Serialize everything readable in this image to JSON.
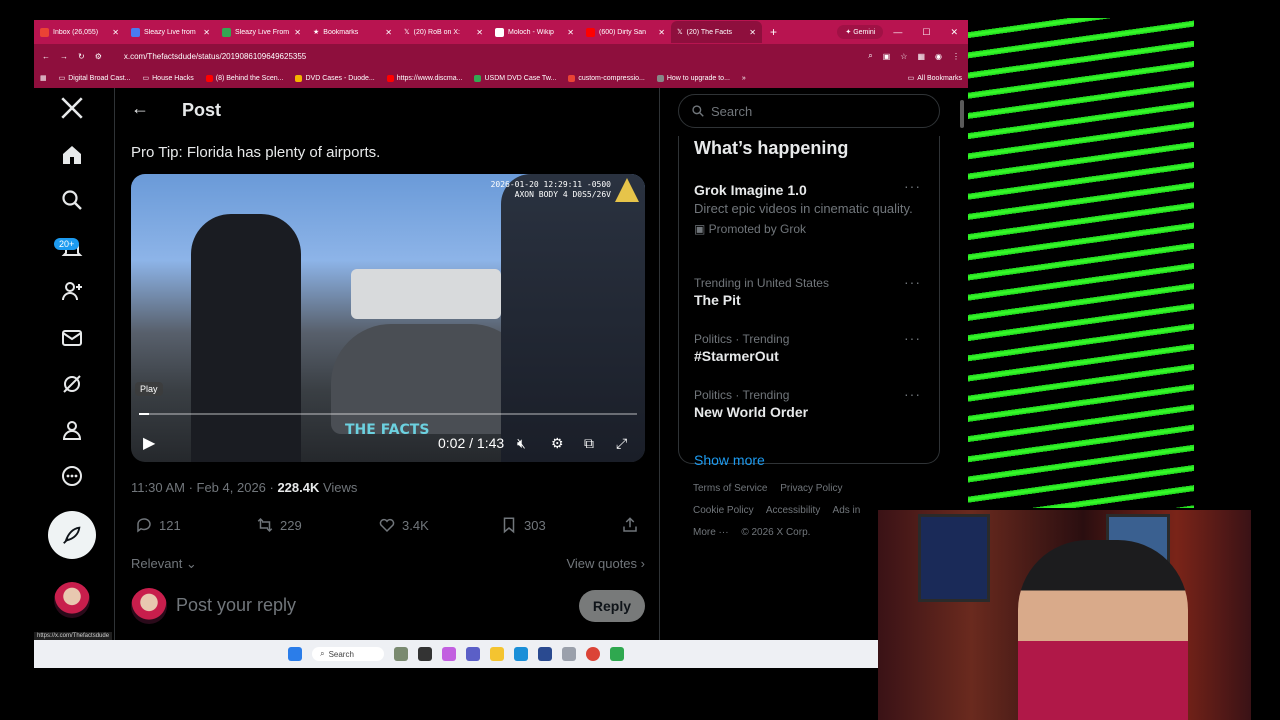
{
  "browser": {
    "tabs": [
      {
        "label": "Inbox (26,055)",
        "color": "#ea4335"
      },
      {
        "label": "Sleazy Live from",
        "color": "#4a7cf0"
      },
      {
        "label": "Sleazy Live From",
        "color": "#34a853"
      },
      {
        "label": "Bookmarks",
        "color": "#ffffff"
      },
      {
        "label": "(20) RoB on X:",
        "color": "#000000"
      },
      {
        "label": "Moloch - Wikip",
        "color": "#ffffff"
      },
      {
        "label": "(600) Dirty San",
        "color": "#ff0000"
      },
      {
        "label": "(20) The Facts",
        "color": "#000000"
      }
    ],
    "gemini_label": "Gemini",
    "url": "x.com/Thefactsdude/status/2019086109649625355",
    "bookmarks": [
      {
        "label": "Digital Broad Cast...",
        "color": "#4a7cf0"
      },
      {
        "label": "House Hacks",
        "color": "#f4b400"
      },
      {
        "label": "(8) Behind the Scen...",
        "color": "#ff0000"
      },
      {
        "label": "DVD Cases - Duode...",
        "color": "#f4b400"
      },
      {
        "label": "https://www.discma...",
        "color": "#ff0000"
      },
      {
        "label": "USDM DVD Case Tw...",
        "color": "#34a853"
      },
      {
        "label": "custom-compressio...",
        "color": "#ea4335"
      },
      {
        "label": "How to upgrade to...",
        "color": "#888888"
      }
    ],
    "all_bookmarks": "All Bookmarks",
    "status_url": "https://x.com/Thefactsdude"
  },
  "nav": {
    "notification_badge": "20+"
  },
  "post": {
    "header_title": "Post",
    "text": "Pro Tip: Florida has plenty of airports.",
    "video": {
      "timestamp_line1": "2026-01-20 12:29:11 -0500",
      "timestamp_line2": "AXON BODY 4 D0S5/26V",
      "play_tooltip": "Play",
      "time": "0:02 / 1:43",
      "watermark": "THE FACTS",
      "progress": 0.02
    },
    "meta_time": "11:30 AM · Feb 4, 2026 · ",
    "views_count": "228.4K",
    "views_label": " Views",
    "replies": "121",
    "reposts": "229",
    "likes": "3.4K",
    "bookmarks": "303",
    "sort_label": "Relevant",
    "view_quotes": "View quotes",
    "reply_placeholder": "Post your reply",
    "reply_button": "Reply"
  },
  "sidebar": {
    "search_placeholder": "Search",
    "whats_happening": "What’s happening",
    "trends": [
      {
        "name": "Grok Imagine 1.0",
        "desc": "Direct epic videos in cinematic quality.",
        "promo": "Promoted by Grok"
      },
      {
        "category": "Trending in United States",
        "name": "The Pit"
      },
      {
        "category": "Politics · Trending",
        "name": "#StarmerOut"
      },
      {
        "category": "Politics · Trending",
        "name": "New World Order"
      }
    ],
    "show_more": "Show more",
    "footer": [
      "Terms of Service",
      "Privacy Policy",
      "Cookie Policy",
      "Accessibility",
      "Ads in",
      "More ···",
      "© 2026 X Corp."
    ]
  },
  "taskbar": {
    "search_label": "Search"
  },
  "colors": {
    "chrome_tab": "#b81450",
    "x_blue": "#1d9bf0",
    "stripe_green": "#39ff2a"
  }
}
